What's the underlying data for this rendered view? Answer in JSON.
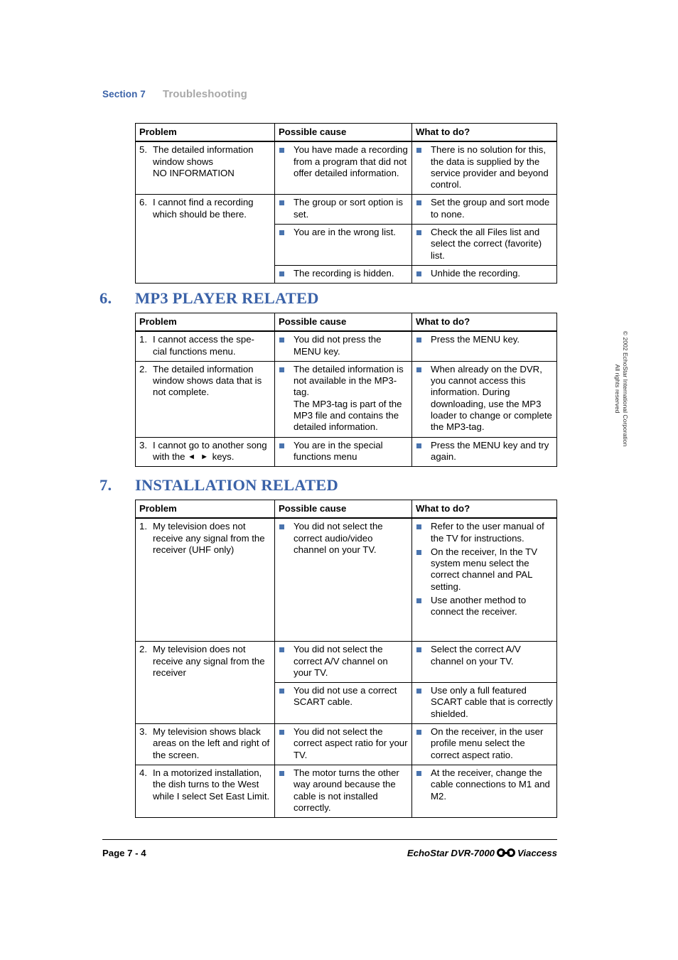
{
  "running_head": {
    "section": "Section 7",
    "chapter": "Troubleshooting"
  },
  "columns": {
    "problem": "Problem",
    "cause": "Possible cause",
    "action": "What to do?"
  },
  "table_continued": {
    "rows": [
      {
        "num": "5.",
        "problem": "The detailed information window shows\nNO INFORMATION",
        "causes": [
          "You have made a recording from a program that did not offer detailed information."
        ],
        "actions": [
          "There is no solution for this, the data is supplied by the service provider and beyond control."
        ]
      },
      {
        "num": "6.",
        "problem": "I cannot find a recording which should be there.",
        "causes": [
          "The group or sort option is set."
        ],
        "actions": [
          "Set the group and sort mode to none."
        ]
      },
      {
        "num": "",
        "problem": "",
        "causes": [
          "You are in the wrong list."
        ],
        "actions": [
          "Check the all Files list and select the correct (favorite) list."
        ]
      },
      {
        "num": "",
        "problem": "",
        "causes": [
          "The recording is hidden."
        ],
        "actions": [
          "Unhide the recording."
        ]
      }
    ]
  },
  "section_mp3": {
    "number": "6.",
    "title": "MP3 PLAYER RELATED",
    "rows": [
      {
        "num": "1.",
        "problem": "I cannot access the spe-\ncial functions menu.",
        "causes": [
          "You did not press the MENU key."
        ],
        "actions": [
          "Press the MENU key."
        ]
      },
      {
        "num": "2.",
        "problem": "The detailed information window shows data that is not complete.",
        "causes": [
          "The detailed information is not available in the MP3-tag.",
          "The MP3-tag is part of the MP3 file and contains the detailed information."
        ],
        "actions": [
          "When already on the DVR, you cannot access this information. During downloading, use the MP3 loader to change or complete the MP3-tag."
        ]
      },
      {
        "num": "3.",
        "problem_pre": "I cannot go to another song with the ",
        "problem_keys": "◄ ►",
        "problem_post": " keys.",
        "causes": [
          "You are in the special functions menu"
        ],
        "actions": [
          "Press the MENU key and try again."
        ]
      }
    ]
  },
  "section_install": {
    "number": "7.",
    "title": "INSTALLATION RELATED",
    "rows": [
      {
        "num": "1.",
        "problem": "My television does not receive any signal from the receiver (UHF only)",
        "causes": [
          "You did not select the correct audio/video channel on your TV."
        ],
        "actions": [
          "Refer to the user manual of the TV for instructions.",
          "On the receiver, In the TV system menu select the correct channel and PAL setting.",
          "Use another method to connect the receiver."
        ]
      },
      {
        "num": "2.",
        "problem": "My television does not receive any signal from the receiver",
        "causes": [
          "You did not select the correct A/V channel on your TV."
        ],
        "actions": [
          "Select the correct A/V channel on your TV."
        ]
      },
      {
        "num": "",
        "problem": "",
        "causes": [
          "You did not use a correct SCART cable."
        ],
        "actions": [
          "Use only a full featured SCART cable that is correctly shielded."
        ]
      },
      {
        "num": "3.",
        "problem": "My television shows black areas on the left and right of the screen.",
        "causes": [
          "You did not select the correct aspect ratio for your TV."
        ],
        "actions": [
          "On the receiver, in the user profile menu select the correct aspect ratio."
        ]
      },
      {
        "num": "4.",
        "problem": "In a motorized installation, the dish turns to the West while I select Set East Limit.",
        "causes": [
          "The motor turns the other way around because the cable is not installed correctly."
        ],
        "actions": [
          "At the receiver, change the cable connections to M1 and M2."
        ]
      }
    ]
  },
  "copyright": {
    "line1": "© 2002 EchoStar International Corporation",
    "line2": "All rights reserved"
  },
  "footer": {
    "page": "Page 7 - 4",
    "product_pre": "EchoStar DVR-7000",
    "logo": "common-interface-logo",
    "product_post": "Viaccess"
  },
  "colors": {
    "heading_blue": "#3a62a8",
    "bullet_blue": "#4a74ae",
    "chapter_gray": "#a8a8a8"
  }
}
